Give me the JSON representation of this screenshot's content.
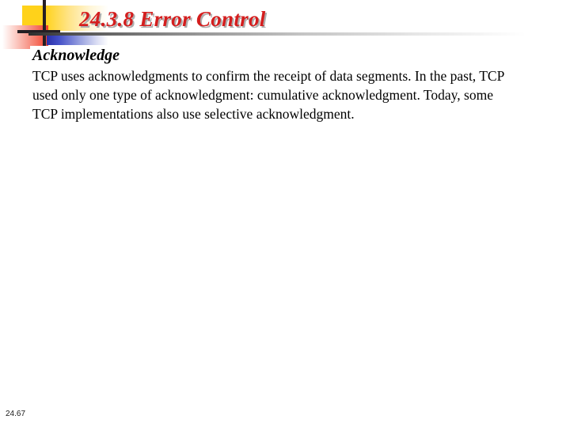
{
  "slide": {
    "title": "24.3.8  Error Control",
    "title_color": "#D41E1E",
    "title_shadow_color": "#AEAEAE",
    "page_number": "24.67"
  },
  "ornament": {
    "yellow_color": "#FFD21A",
    "red_color": "#F2402B",
    "blue_color": "#2A2FA8",
    "bar_color": "#241F24"
  },
  "content": {
    "subhead": "Acknowledge",
    "paragraphs": [
      "TCP uses acknowledgments to confirm the receipt of data segments. In the past, TCP used only one type of acknowledgment: cumulative acknowledgment. Today, some TCP implementations also use selective acknowledgment."
    ]
  }
}
